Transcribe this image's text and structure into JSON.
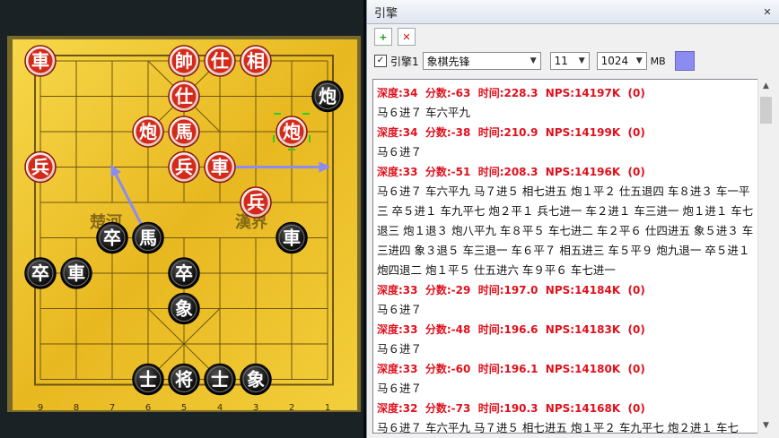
{
  "panel": {
    "title": "引擎",
    "engine_label": "引擎1",
    "engine_name": "象棋先锋",
    "threads": "11",
    "hash": "1024",
    "hash_unit": "MB",
    "engine_checked": true,
    "color": "#8a8cf2"
  },
  "board": {
    "bottom_files": [
      "9",
      "8",
      "7",
      "6",
      "5",
      "4",
      "3",
      "2",
      "1"
    ],
    "left_label": "楚河",
    "right_label": "漢界",
    "red_pieces": [
      {
        "label": "車",
        "file": 0,
        "rank": 0
      },
      {
        "label": "帥",
        "file": 4,
        "rank": 0
      },
      {
        "label": "仕",
        "file": 5,
        "rank": 0
      },
      {
        "label": "相",
        "file": 6,
        "rank": 0
      },
      {
        "label": "仕",
        "file": 4,
        "rank": 1
      },
      {
        "label": "炮",
        "file": 3,
        "rank": 2
      },
      {
        "label": "馬",
        "file": 4,
        "rank": 2
      },
      {
        "label": "炮",
        "file": 7,
        "rank": 2
      },
      {
        "label": "兵",
        "file": 0,
        "rank": 3
      },
      {
        "label": "兵",
        "file": 4,
        "rank": 3
      },
      {
        "label": "車",
        "file": 5,
        "rank": 3
      },
      {
        "label": "兵",
        "file": 6,
        "rank": 4
      }
    ],
    "black_pieces": [
      {
        "label": "炮",
        "file": 8,
        "rank": 1
      },
      {
        "label": "卒",
        "file": 2,
        "rank": 5
      },
      {
        "label": "馬",
        "file": 3,
        "rank": 5
      },
      {
        "label": "車",
        "file": 7,
        "rank": 5
      },
      {
        "label": "卒",
        "file": 0,
        "rank": 6
      },
      {
        "label": "車",
        "file": 1,
        "rank": 6
      },
      {
        "label": "卒",
        "file": 4,
        "rank": 6
      },
      {
        "label": "象",
        "file": 4,
        "rank": 7
      },
      {
        "label": "士",
        "file": 3,
        "rank": 9
      },
      {
        "label": "将",
        "file": 4,
        "rank": 9
      },
      {
        "label": "士",
        "file": 5,
        "rank": 9
      },
      {
        "label": "象",
        "file": 6,
        "rank": 9
      }
    ]
  },
  "analysis": [
    {
      "header": "深度:34  分数:-63  时间:228.3  NPS:14197K  (0)",
      "moves": "马６进７ 车六平九"
    },
    {
      "header": "深度:34  分数:-38  时间:210.9  NPS:14199K  (0)",
      "moves": "马６进７"
    },
    {
      "header": "深度:33  分数:-51  时间:208.3  NPS:14196K  (0)",
      "moves": "马６进７ 车六平九 马７进５ 相七进五 炮１平２ 仕五退四 车８进３ 车一平三 卒５进１ 车九平七 炮２平１ 兵七进一 车２进１ 车三进一 炮１进１ 车七退三 炮１退３ 炮八平九 车８平５ 车七进二 车２平６ 仕四进五 象５进３ 车三进四 象３退５ 车三退一 车６平７ 相五进三 车５平９ 炮九退一 卒５进１ 炮四退二 炮１平５ 仕五进六 车９平６ 车七进一"
    },
    {
      "header": "深度:33  分数:-29  时间:197.0  NPS:14184K  (0)",
      "moves": "马６进７"
    },
    {
      "header": "深度:33  分数:-48  时间:196.6  NPS:14183K  (0)",
      "moves": "马６进７"
    },
    {
      "header": "深度:33  分数:-60  时间:196.1  NPS:14180K  (0)",
      "moves": "马６进７"
    },
    {
      "header": "深度:32  分数:-73  时间:190.3  NPS:14168K  (0)",
      "moves": "马６进７ 车六平九 马７进５ 相七进五 炮１平２ 车九平七 炮２进１ 车七"
    }
  ]
}
